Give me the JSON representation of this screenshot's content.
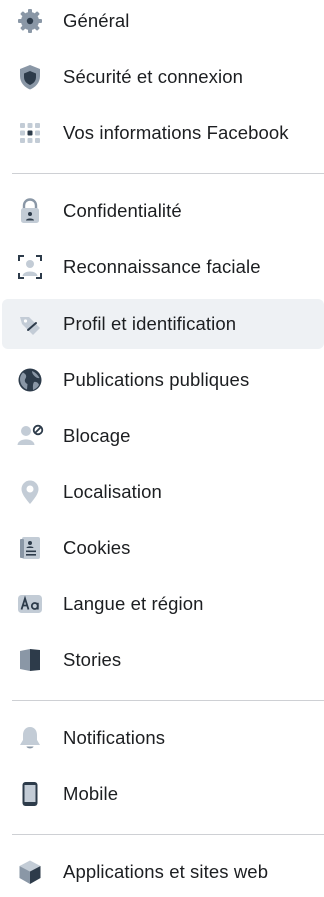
{
  "sections": [
    {
      "items": [
        {
          "label": "Général",
          "icon": "gear-icon"
        },
        {
          "label": "Sécurité et connexion",
          "icon": "shield-icon"
        },
        {
          "label": "Vos informations Facebook",
          "icon": "grid-icon"
        }
      ]
    },
    {
      "items": [
        {
          "label": "Confidentialité",
          "icon": "lock-icon"
        },
        {
          "label": "Reconnaissance faciale",
          "icon": "face-scan-icon"
        },
        {
          "label": "Profil et identification",
          "icon": "tag-icon",
          "selected": true
        },
        {
          "label": "Publications publiques",
          "icon": "globe-icon"
        },
        {
          "label": "Blocage",
          "icon": "person-blocked-icon"
        },
        {
          "label": "Localisation",
          "icon": "location-pin-icon"
        },
        {
          "label": "Cookies",
          "icon": "document-icon"
        },
        {
          "label": "Langue et région",
          "icon": "language-icon"
        },
        {
          "label": "Stories",
          "icon": "book-icon"
        }
      ]
    },
    {
      "items": [
        {
          "label": "Notifications",
          "icon": "bell-icon"
        },
        {
          "label": "Mobile",
          "icon": "phone-icon"
        }
      ]
    },
    {
      "items": [
        {
          "label": "Applications et sites web",
          "icon": "cube-icon"
        }
      ]
    }
  ],
  "colors": {
    "text": "#1c1e21",
    "icon_gray": "#8a97a6",
    "icon_dark": "#2d3b4a",
    "selected_bg": "#eef1f4",
    "divider": "#ced0d4"
  }
}
